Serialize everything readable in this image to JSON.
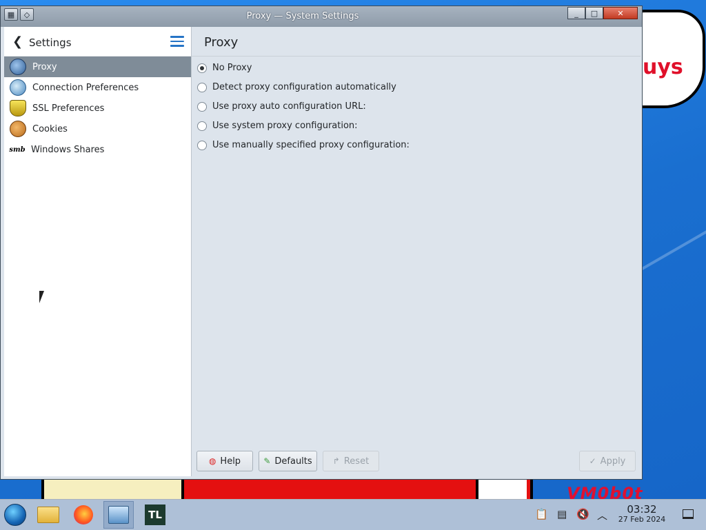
{
  "window": {
    "title": "Proxy — System Settings",
    "controls": {
      "minimize": "_",
      "maximize": "□",
      "close": "✕"
    }
  },
  "sidebar": {
    "back_label": "Settings",
    "items": [
      {
        "label": "Proxy",
        "icon": "proxy-icon",
        "selected": true
      },
      {
        "label": "Connection Preferences",
        "icon": "connection-preferences-icon"
      },
      {
        "label": "SSL Preferences",
        "icon": "ssl-shield-icon"
      },
      {
        "label": "Cookies",
        "icon": "cookie-icon"
      },
      {
        "label": "Windows Shares",
        "icon": "smb-icon",
        "icon_text": "smb"
      }
    ]
  },
  "main": {
    "title": "Proxy",
    "options": [
      {
        "label": "No Proxy",
        "checked": true
      },
      {
        "label": "Detect proxy configuration automatically",
        "checked": false
      },
      {
        "label": "Use proxy auto configuration URL:",
        "checked": false
      },
      {
        "label": "Use system proxy configuration:",
        "checked": false
      },
      {
        "label": "Use manually specified proxy configuration:",
        "checked": false
      }
    ],
    "buttons": {
      "help": "Help",
      "defaults": "Defaults",
      "reset": "Reset",
      "apply": "Apply"
    }
  },
  "desktop": {
    "bubble_text": "uys",
    "watermark": "VM0b0t"
  },
  "taskbar": {
    "tl_label": "TL",
    "clock_time": "03:32",
    "clock_date": "27 Feb 2024"
  }
}
